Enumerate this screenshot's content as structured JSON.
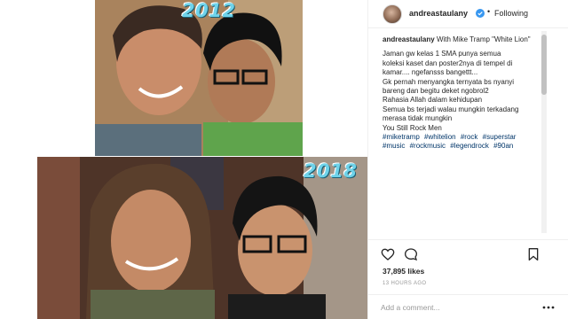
{
  "photo": {
    "year_top": "2012",
    "year_bottom": "2018"
  },
  "post": {
    "username": "andreastaulany",
    "verified": true,
    "dot": "•",
    "follow_status": "Following",
    "caption": {
      "author": "andreastaulany",
      "head_text": "With Mike Tramp \"White Lion\"",
      "lines": [
        "Jaman gw kelas 1 SMA punya semua",
        "koleksi kaset dan poster2nya di tempel di",
        "kamar.... ngefansss bangettt...",
        "Gk pernah menyangka ternyata bs nyanyi",
        "bareng dan begitu deket ngobrol2",
        "Rahasia Allah dalam kehidupan",
        "Semua bs terjadi walau mungkin terkadang",
        "merasa tidak mungkin",
        "You Still Rock Men"
      ],
      "hashtags_line1": [
        "#miketramp",
        "#whitelion",
        "#rock",
        "#superstar"
      ],
      "hashtags_line2": [
        "#music",
        "#rockmusic",
        "#legendrock",
        "#90an"
      ]
    },
    "likes": "37,895 likes",
    "time_ago": "13 HOURS AGO",
    "comment_placeholder": "Add a comment...",
    "icons": {
      "like": "heart-icon",
      "comment": "comment-icon",
      "save": "bookmark-icon",
      "options": "more-options-icon",
      "verified": "verified-badge-icon"
    },
    "colors": {
      "hashtag": "#003569",
      "verified": "#3897f0",
      "year_label": "#6fd3ea"
    }
  }
}
